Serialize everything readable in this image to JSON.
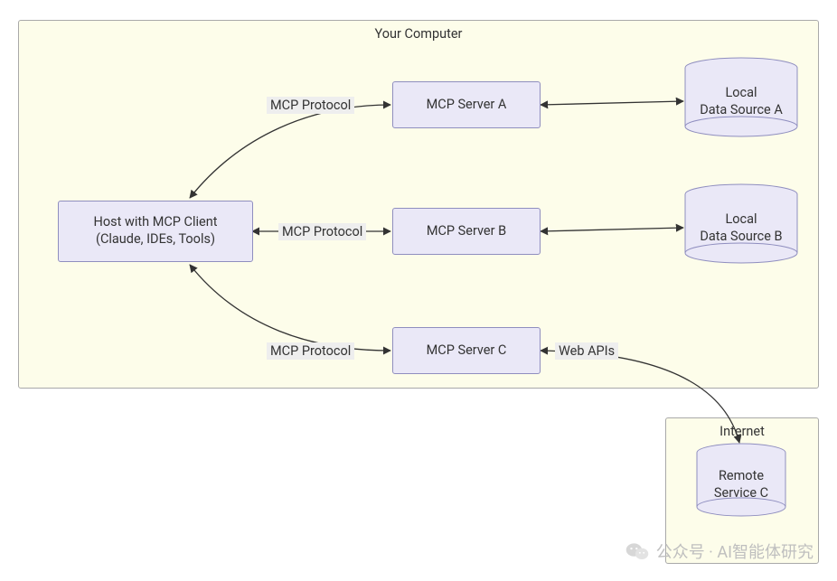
{
  "zones": {
    "computer": {
      "label": "Your Computer"
    },
    "internet": {
      "label": "Internet"
    }
  },
  "nodes": {
    "host": {
      "line1": "Host with MCP Client",
      "line2": "(Claude, IDEs, Tools)"
    },
    "serverA": {
      "label": "MCP Server A"
    },
    "serverB": {
      "label": "MCP Server B"
    },
    "serverC": {
      "label": "MCP Server C"
    },
    "sourceA": {
      "line1": "Local",
      "line2": "Data Source A"
    },
    "sourceB": {
      "line1": "Local",
      "line2": "Data Source B"
    },
    "remoteC": {
      "line1": "Remote",
      "line2": "Service C"
    }
  },
  "edges": {
    "protoA": "MCP Protocol",
    "protoB": "MCP Protocol",
    "protoC": "MCP Protocol",
    "webapis": "Web APIs"
  },
  "watermark": "公众号 · AI智能体研究"
}
